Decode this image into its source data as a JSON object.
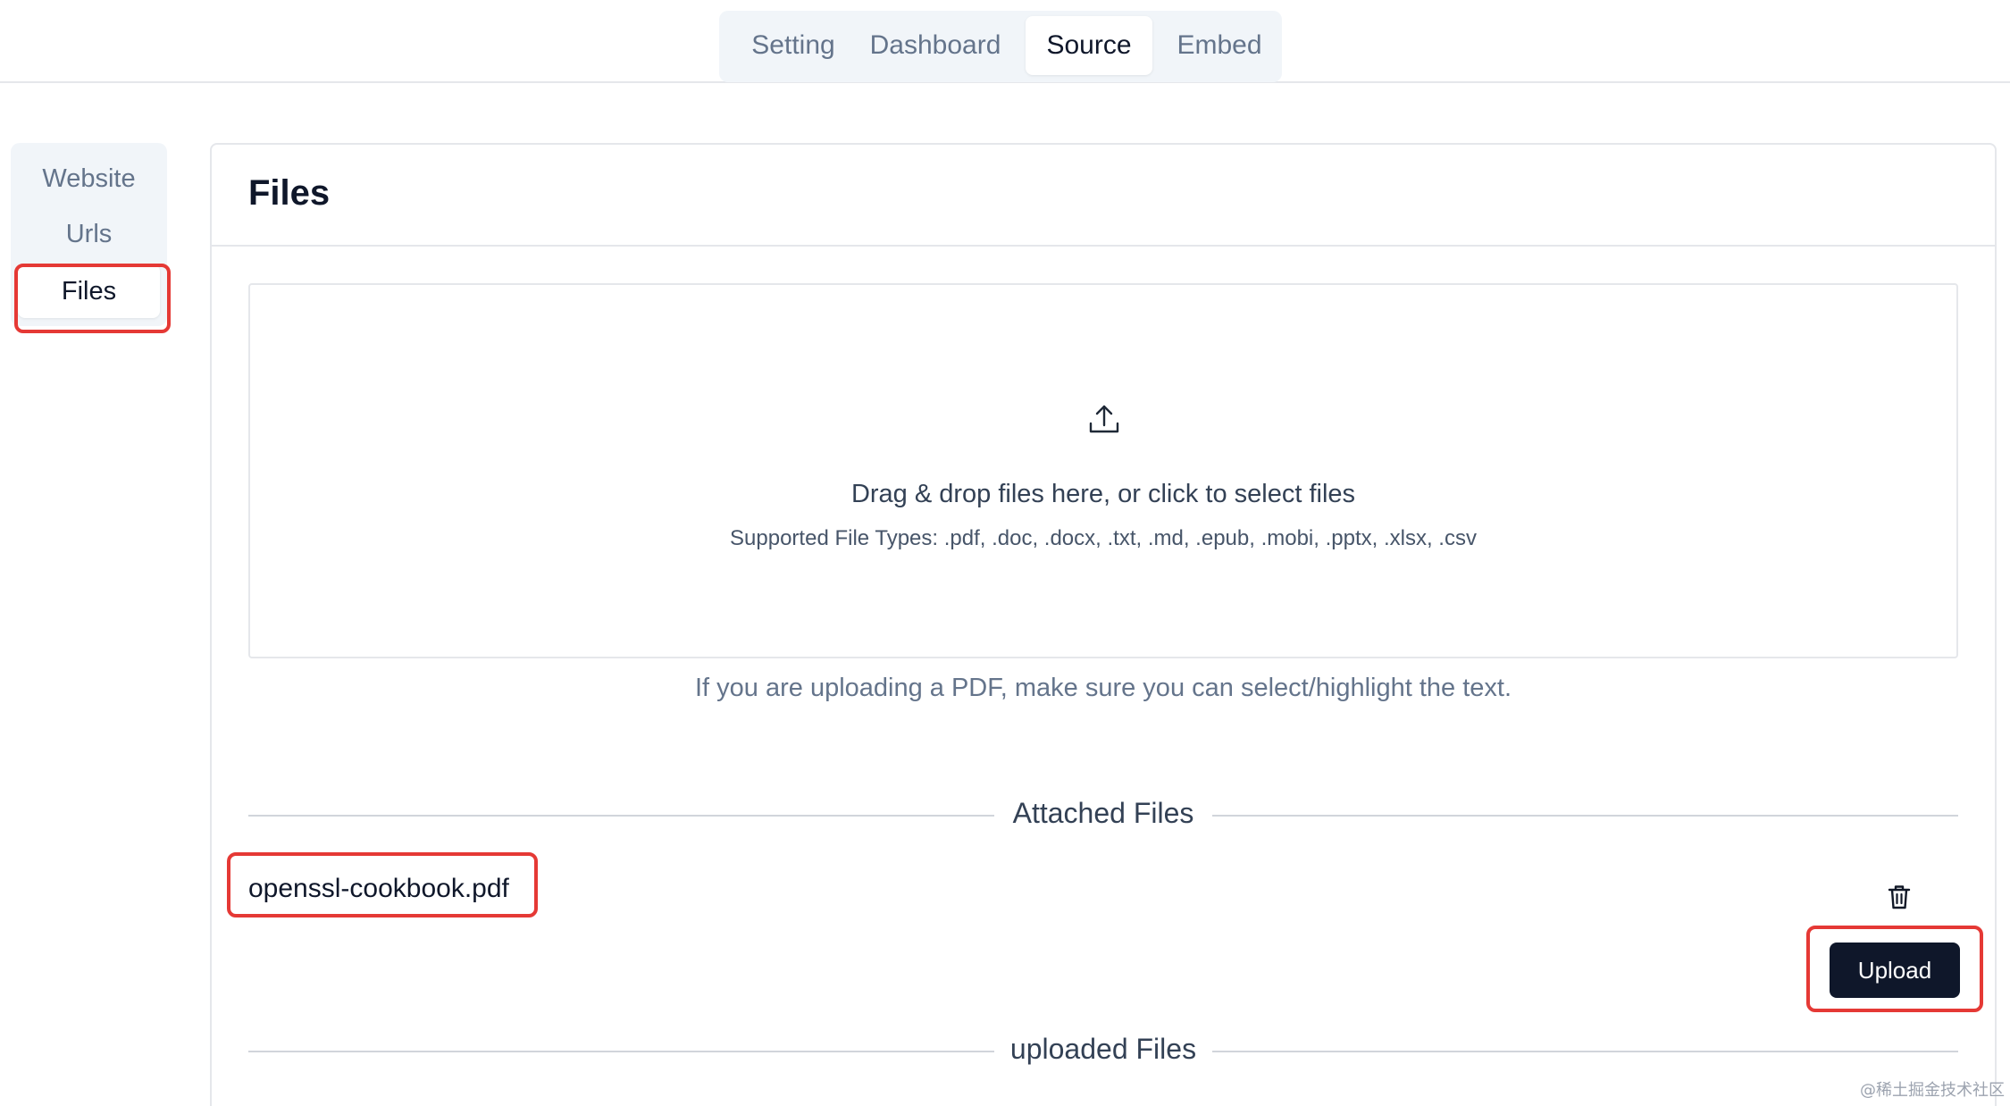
{
  "top_tabs": {
    "items": [
      {
        "label": "Setting",
        "active": false
      },
      {
        "label": "Dashboard",
        "active": false
      },
      {
        "label": "Source",
        "active": true
      },
      {
        "label": "Embed",
        "active": false
      }
    ]
  },
  "side_nav": {
    "items": [
      {
        "label": "Website",
        "active": false
      },
      {
        "label": "Urls",
        "active": false
      },
      {
        "label": "Files",
        "active": true
      }
    ]
  },
  "main": {
    "title": "Files",
    "dropzone": {
      "icon": "upload-icon",
      "title": "Drag & drop files here, or click to select files",
      "subtitle": "Supported File Types: .pdf, .doc, .docx, .txt, .md, .epub, .mobi, .pptx, .xlsx, .csv"
    },
    "pdf_note": "If you are uploading a PDF, make sure you can select/highlight the text.",
    "attached_section": {
      "label": "Attached Files",
      "files": [
        {
          "name": "openssl-cookbook.pdf",
          "action_icon": "trash-icon"
        }
      ]
    },
    "upload_button": "Upload",
    "uploaded_section": {
      "label": "uploaded Files"
    }
  },
  "watermark": "@稀土掘金技术社区",
  "colors": {
    "highlight": "#e53935",
    "primary_button": "#0f172a",
    "tab_bg": "#f1f5f9",
    "muted_text": "#64748b"
  }
}
